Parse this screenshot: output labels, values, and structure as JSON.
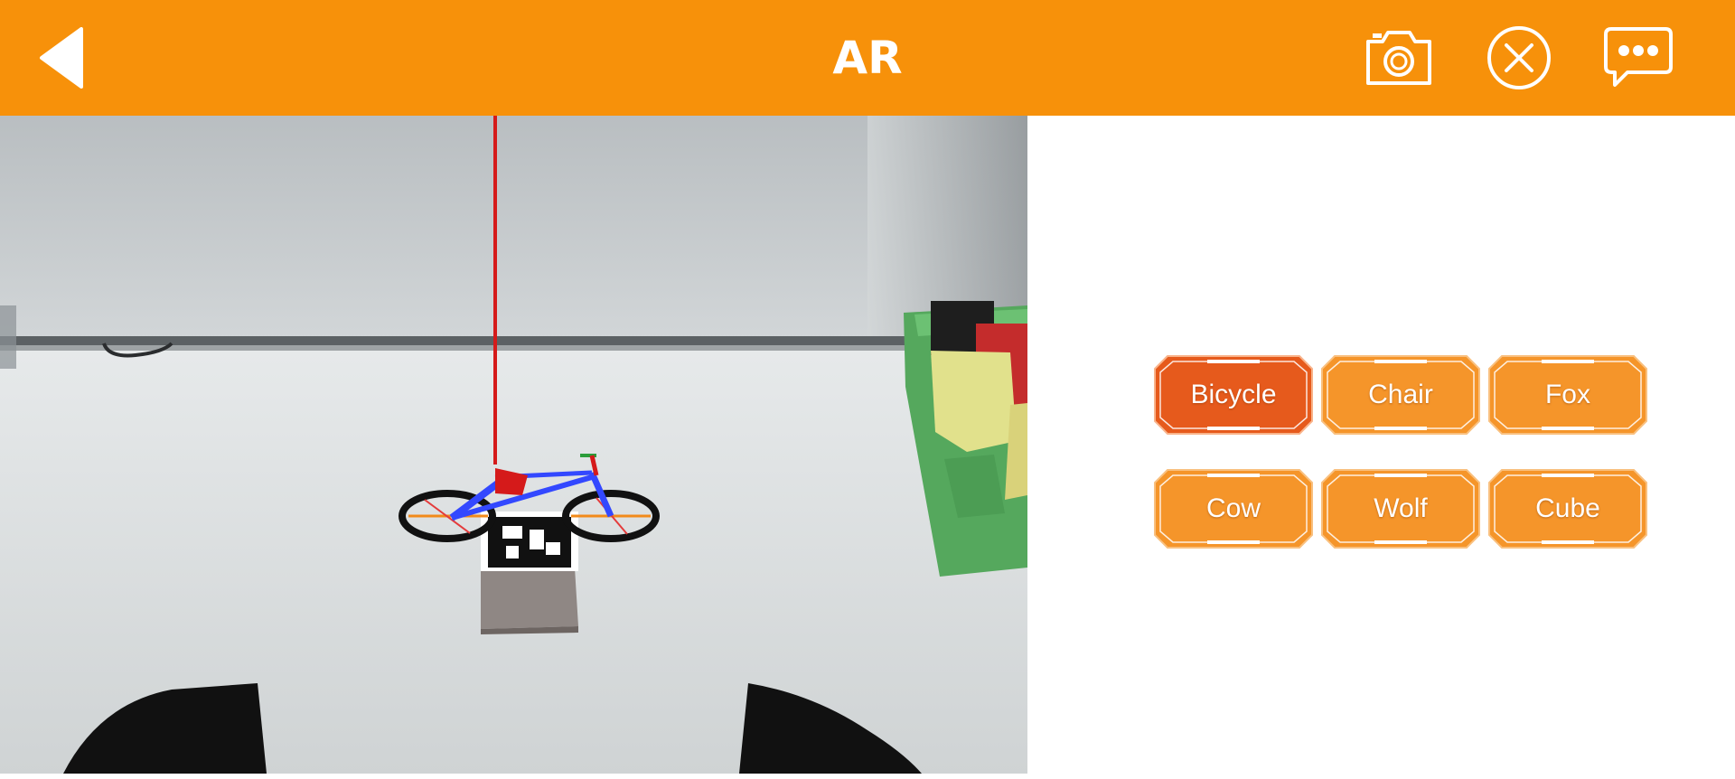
{
  "app": {
    "title": "AR"
  },
  "header": {
    "back_icon": "back-arrow-icon",
    "camera_icon": "camera-icon",
    "close_icon": "close-circle-icon",
    "chat_icon": "chat-bubble-icon"
  },
  "colors": {
    "accent": "#f7910a",
    "button": "#f5952a",
    "button_selected": "#e65a1c"
  },
  "models": [
    {
      "label": "Bicycle",
      "selected": true
    },
    {
      "label": "Chair",
      "selected": false
    },
    {
      "label": "Fox",
      "selected": false
    },
    {
      "label": "Cow",
      "selected": false
    },
    {
      "label": "Wolf",
      "selected": false
    },
    {
      "label": "Cube",
      "selected": false
    }
  ]
}
